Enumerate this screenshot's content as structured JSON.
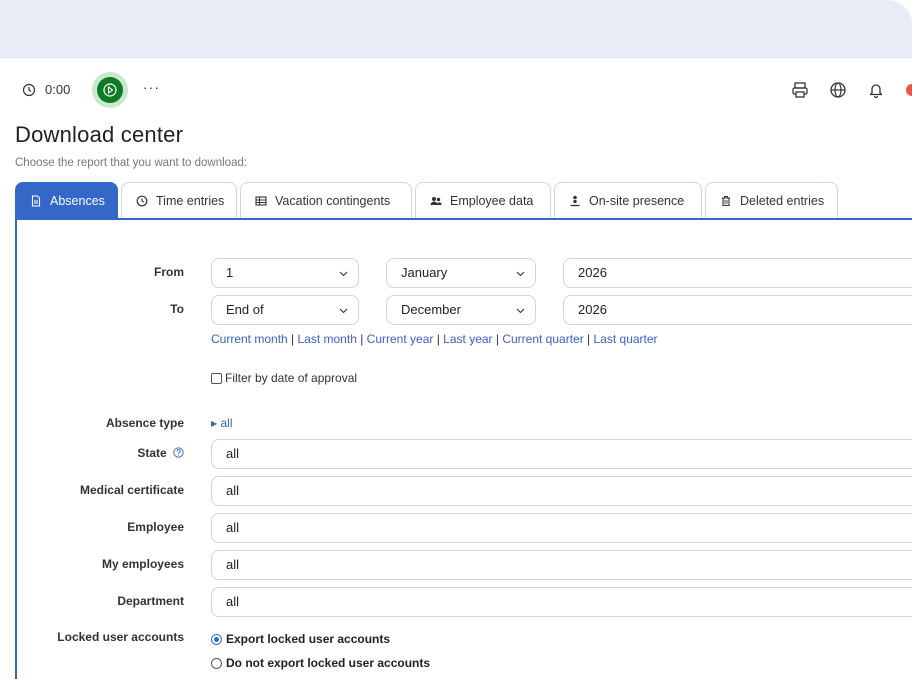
{
  "toolbar": {
    "timer": "0:00",
    "more": "···",
    "icons": [
      "clock-icon",
      "play-icon",
      "more-icon",
      "print-icon",
      "globe-icon",
      "bell-icon"
    ]
  },
  "page": {
    "title": "Download center",
    "subtitle": "Choose the report that you want to download:"
  },
  "tabs": [
    {
      "label": "Absences",
      "icon": "document-icon",
      "active": true
    },
    {
      "label": "Time entries",
      "icon": "clock-icon"
    },
    {
      "label": "Vacation contingents",
      "icon": "table-icon"
    },
    {
      "label": "Employee data",
      "icon": "users-icon"
    },
    {
      "label": "On-site presence",
      "icon": "person-pin-icon"
    },
    {
      "label": "Deleted entries",
      "icon": "trash-icon"
    }
  ],
  "form": {
    "from": {
      "label": "From",
      "day": "1",
      "month": "January",
      "year": "2026"
    },
    "to": {
      "label": "To",
      "day": "End of",
      "month": "December",
      "year": "2026"
    },
    "quick_links": [
      "Current month",
      "Last month",
      "Current year",
      "Last year",
      "Current quarter",
      "Last quarter"
    ],
    "filter_approval": {
      "label": "Filter by date of approval",
      "checked": false
    },
    "absence_type": {
      "label": "Absence type",
      "value": "all"
    },
    "state": {
      "label": "State",
      "value": "all"
    },
    "medical_certificate": {
      "label": "Medical certificate",
      "value": "all"
    },
    "employee": {
      "label": "Employee",
      "value": "all"
    },
    "my_employees": {
      "label": "My employees",
      "value": "all"
    },
    "department": {
      "label": "Department",
      "value": "all"
    },
    "locked_accounts": {
      "label": "Locked user accounts",
      "options": [
        {
          "label": "Export locked user accounts",
          "checked": true
        },
        {
          "label": "Do not export locked user accounts",
          "checked": false
        }
      ]
    }
  },
  "colors": {
    "accent": "#3367c8",
    "link": "#3a62c0",
    "play": "#0f7a24",
    "topband": "#e9edf7"
  }
}
